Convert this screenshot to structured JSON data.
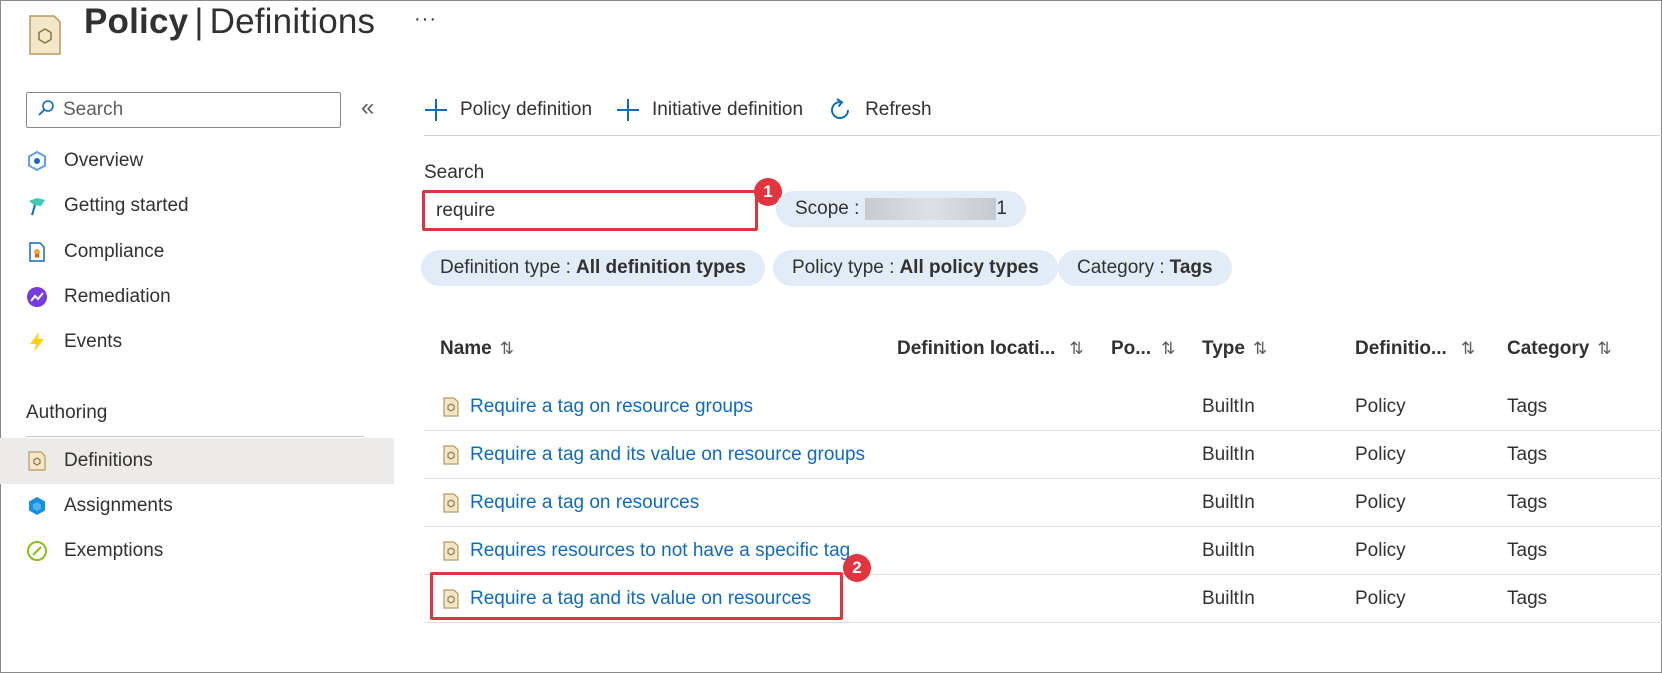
{
  "header": {
    "title_bold": "Policy",
    "separator": "|",
    "title_rest": "Definitions",
    "more": "···"
  },
  "sidebar": {
    "search_placeholder": "Search",
    "collapse": "«",
    "items": [
      {
        "label": "Overview",
        "icon": "overview-icon"
      },
      {
        "label": "Getting started",
        "icon": "getting-started-icon"
      },
      {
        "label": "Compliance",
        "icon": "compliance-icon"
      },
      {
        "label": "Remediation",
        "icon": "remediation-icon"
      },
      {
        "label": "Events",
        "icon": "lightning-icon"
      }
    ],
    "section_label": "Authoring",
    "authoring_items": [
      {
        "label": "Definitions",
        "icon": "definition-icon",
        "active": true
      },
      {
        "label": "Assignments",
        "icon": "assignment-icon"
      },
      {
        "label": "Exemptions",
        "icon": "exemption-icon"
      }
    ]
  },
  "toolbar": {
    "policy_definition": "Policy definition",
    "initiative_definition": "Initiative definition",
    "refresh": "Refresh"
  },
  "filters": {
    "search_label": "Search",
    "search_value": "require",
    "scope_label": "Scope :",
    "scope_suffix": "1",
    "definition_type_label": "Definition type :",
    "definition_type_value": "All definition types",
    "policy_type_label": "Policy type :",
    "policy_type_value": "All policy types",
    "category_label": "Category :",
    "category_value": "Tags"
  },
  "callouts": {
    "one": "1",
    "two": "2"
  },
  "table": {
    "columns": {
      "name": "Name",
      "definition_location": "Definition locati...",
      "policies": "Po...",
      "type": "Type",
      "definition": "Definitio...",
      "category": "Category",
      "sort_glyph": "⇅"
    },
    "rows": [
      {
        "name": "Require a tag on resource groups",
        "type": "BuiltIn",
        "definition": "Policy",
        "category": "Tags"
      },
      {
        "name": "Require a tag and its value on resource groups",
        "type": "BuiltIn",
        "definition": "Policy",
        "category": "Tags"
      },
      {
        "name": "Require a tag on resources",
        "type": "BuiltIn",
        "definition": "Policy",
        "category": "Tags"
      },
      {
        "name": "Requires resources to not have a specific tag",
        "type": "BuiltIn",
        "definition": "Policy",
        "category": "Tags"
      },
      {
        "name": "Require a tag and its value on resources",
        "type": "BuiltIn",
        "definition": "Policy",
        "category": "Tags"
      }
    ]
  },
  "colors": {
    "link": "#0f6cbd",
    "highlight": "#e0343e",
    "pill": "#e1ecf7",
    "active_nav": "#edebe9"
  }
}
